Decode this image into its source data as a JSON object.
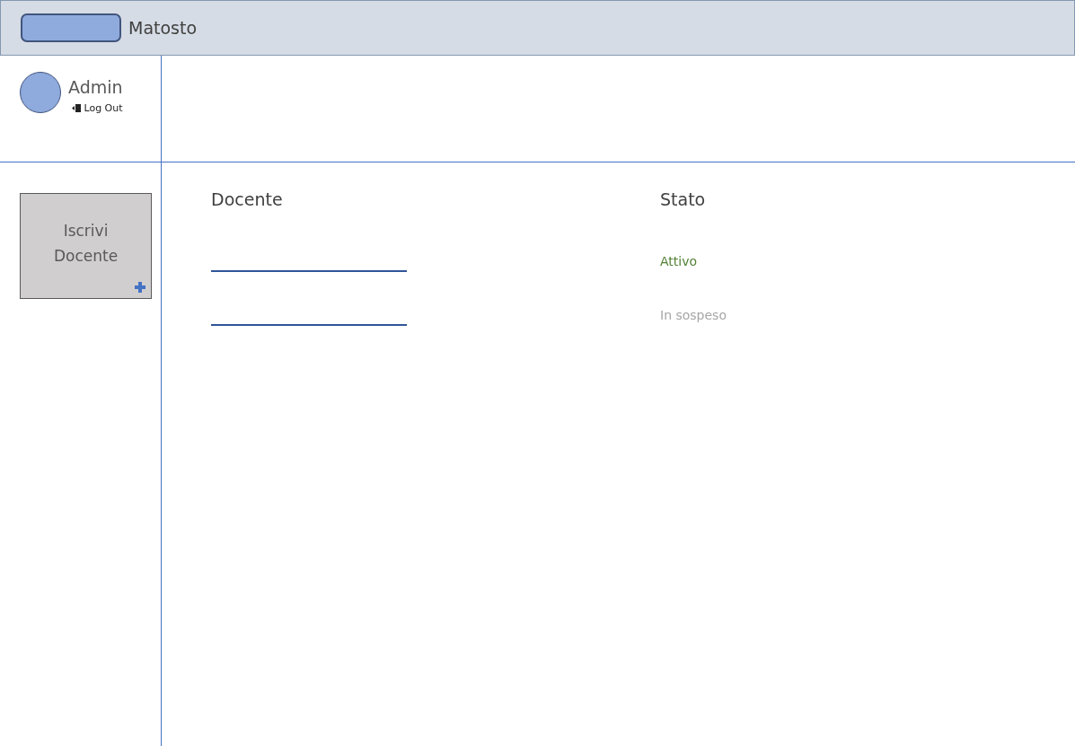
{
  "header": {
    "title": "Matosto"
  },
  "user": {
    "name": "Admin",
    "logout": "Log Out"
  },
  "sidebar": {
    "button": {
      "line1": "Iscrivi",
      "line2": "Docente"
    }
  },
  "table": {
    "columns": [
      "Docente",
      "Stato"
    ],
    "rows": [
      {
        "status": "Attivo",
        "active": true
      },
      {
        "status": "In sospeso",
        "active": false
      }
    ]
  }
}
